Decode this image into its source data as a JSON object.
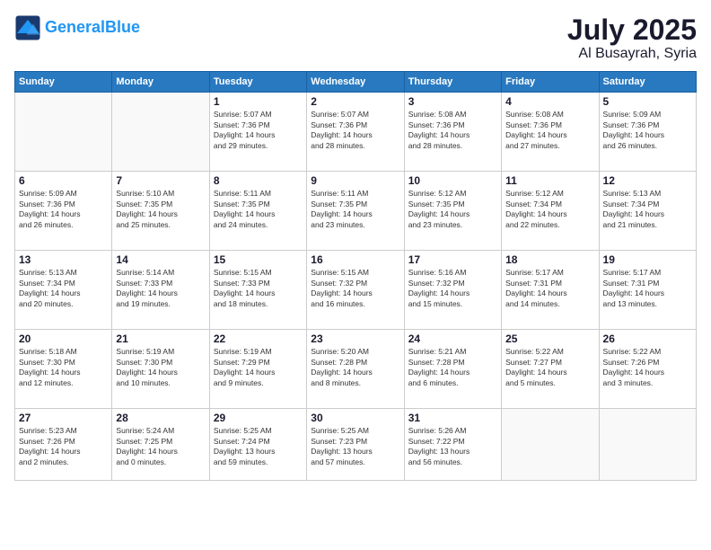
{
  "header": {
    "logo_general": "General",
    "logo_blue": "Blue",
    "month": "July 2025",
    "location": "Al Busayrah, Syria"
  },
  "weekdays": [
    "Sunday",
    "Monday",
    "Tuesday",
    "Wednesday",
    "Thursday",
    "Friday",
    "Saturday"
  ],
  "weeks": [
    [
      {
        "day": "",
        "info": ""
      },
      {
        "day": "",
        "info": ""
      },
      {
        "day": "1",
        "info": "Sunrise: 5:07 AM\nSunset: 7:36 PM\nDaylight: 14 hours\nand 29 minutes."
      },
      {
        "day": "2",
        "info": "Sunrise: 5:07 AM\nSunset: 7:36 PM\nDaylight: 14 hours\nand 28 minutes."
      },
      {
        "day": "3",
        "info": "Sunrise: 5:08 AM\nSunset: 7:36 PM\nDaylight: 14 hours\nand 28 minutes."
      },
      {
        "day": "4",
        "info": "Sunrise: 5:08 AM\nSunset: 7:36 PM\nDaylight: 14 hours\nand 27 minutes."
      },
      {
        "day": "5",
        "info": "Sunrise: 5:09 AM\nSunset: 7:36 PM\nDaylight: 14 hours\nand 26 minutes."
      }
    ],
    [
      {
        "day": "6",
        "info": "Sunrise: 5:09 AM\nSunset: 7:36 PM\nDaylight: 14 hours\nand 26 minutes."
      },
      {
        "day": "7",
        "info": "Sunrise: 5:10 AM\nSunset: 7:35 PM\nDaylight: 14 hours\nand 25 minutes."
      },
      {
        "day": "8",
        "info": "Sunrise: 5:11 AM\nSunset: 7:35 PM\nDaylight: 14 hours\nand 24 minutes."
      },
      {
        "day": "9",
        "info": "Sunrise: 5:11 AM\nSunset: 7:35 PM\nDaylight: 14 hours\nand 23 minutes."
      },
      {
        "day": "10",
        "info": "Sunrise: 5:12 AM\nSunset: 7:35 PM\nDaylight: 14 hours\nand 23 minutes."
      },
      {
        "day": "11",
        "info": "Sunrise: 5:12 AM\nSunset: 7:34 PM\nDaylight: 14 hours\nand 22 minutes."
      },
      {
        "day": "12",
        "info": "Sunrise: 5:13 AM\nSunset: 7:34 PM\nDaylight: 14 hours\nand 21 minutes."
      }
    ],
    [
      {
        "day": "13",
        "info": "Sunrise: 5:13 AM\nSunset: 7:34 PM\nDaylight: 14 hours\nand 20 minutes."
      },
      {
        "day": "14",
        "info": "Sunrise: 5:14 AM\nSunset: 7:33 PM\nDaylight: 14 hours\nand 19 minutes."
      },
      {
        "day": "15",
        "info": "Sunrise: 5:15 AM\nSunset: 7:33 PM\nDaylight: 14 hours\nand 18 minutes."
      },
      {
        "day": "16",
        "info": "Sunrise: 5:15 AM\nSunset: 7:32 PM\nDaylight: 14 hours\nand 16 minutes."
      },
      {
        "day": "17",
        "info": "Sunrise: 5:16 AM\nSunset: 7:32 PM\nDaylight: 14 hours\nand 15 minutes."
      },
      {
        "day": "18",
        "info": "Sunrise: 5:17 AM\nSunset: 7:31 PM\nDaylight: 14 hours\nand 14 minutes."
      },
      {
        "day": "19",
        "info": "Sunrise: 5:17 AM\nSunset: 7:31 PM\nDaylight: 14 hours\nand 13 minutes."
      }
    ],
    [
      {
        "day": "20",
        "info": "Sunrise: 5:18 AM\nSunset: 7:30 PM\nDaylight: 14 hours\nand 12 minutes."
      },
      {
        "day": "21",
        "info": "Sunrise: 5:19 AM\nSunset: 7:30 PM\nDaylight: 14 hours\nand 10 minutes."
      },
      {
        "day": "22",
        "info": "Sunrise: 5:19 AM\nSunset: 7:29 PM\nDaylight: 14 hours\nand 9 minutes."
      },
      {
        "day": "23",
        "info": "Sunrise: 5:20 AM\nSunset: 7:28 PM\nDaylight: 14 hours\nand 8 minutes."
      },
      {
        "day": "24",
        "info": "Sunrise: 5:21 AM\nSunset: 7:28 PM\nDaylight: 14 hours\nand 6 minutes."
      },
      {
        "day": "25",
        "info": "Sunrise: 5:22 AM\nSunset: 7:27 PM\nDaylight: 14 hours\nand 5 minutes."
      },
      {
        "day": "26",
        "info": "Sunrise: 5:22 AM\nSunset: 7:26 PM\nDaylight: 14 hours\nand 3 minutes."
      }
    ],
    [
      {
        "day": "27",
        "info": "Sunrise: 5:23 AM\nSunset: 7:26 PM\nDaylight: 14 hours\nand 2 minutes."
      },
      {
        "day": "28",
        "info": "Sunrise: 5:24 AM\nSunset: 7:25 PM\nDaylight: 14 hours\nand 0 minutes."
      },
      {
        "day": "29",
        "info": "Sunrise: 5:25 AM\nSunset: 7:24 PM\nDaylight: 13 hours\nand 59 minutes."
      },
      {
        "day": "30",
        "info": "Sunrise: 5:25 AM\nSunset: 7:23 PM\nDaylight: 13 hours\nand 57 minutes."
      },
      {
        "day": "31",
        "info": "Sunrise: 5:26 AM\nSunset: 7:22 PM\nDaylight: 13 hours\nand 56 minutes."
      },
      {
        "day": "",
        "info": ""
      },
      {
        "day": "",
        "info": ""
      }
    ]
  ]
}
